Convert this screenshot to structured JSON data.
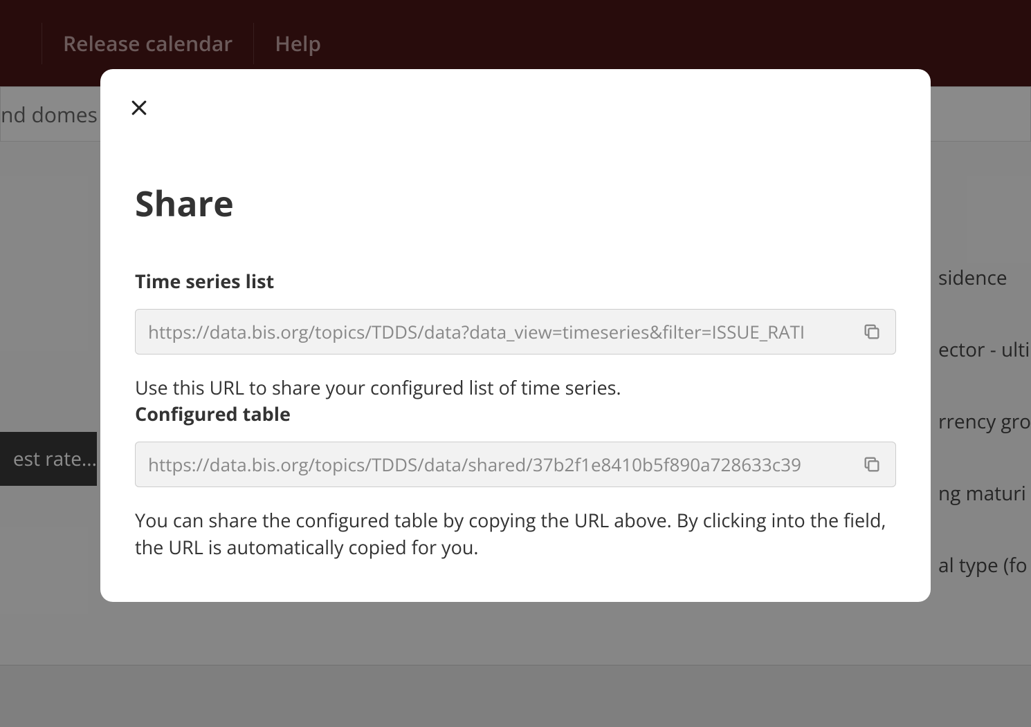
{
  "header": {
    "nav_release_calendar": "Release calendar",
    "nav_help": "Help"
  },
  "breadcrumb": {
    "fragment": "nd domes"
  },
  "left_filters": {
    "selected_fragment": "est rate..."
  },
  "right_filters": {
    "item1": "sidence",
    "item2": "ector - ulti",
    "item3": "rrency gro",
    "item4": "ng maturi",
    "item5": "al type (fo"
  },
  "modal": {
    "title": "Share",
    "close_label": "Close",
    "section1": {
      "label": "Time series list",
      "url": "https://data.bis.org/topics/TDDS/data?data_view=timeseries&filter=ISSUE_RATI",
      "help": "Use this URL to share your configured list of time series."
    },
    "section2": {
      "label": "Configured table",
      "url": "https://data.bis.org/topics/TDDS/data/shared/37b2f1e8410b5f890a728633c39",
      "help": "You can share the configured table by copying the URL above. By clicking into the field, the URL is automatically copied for you."
    }
  }
}
